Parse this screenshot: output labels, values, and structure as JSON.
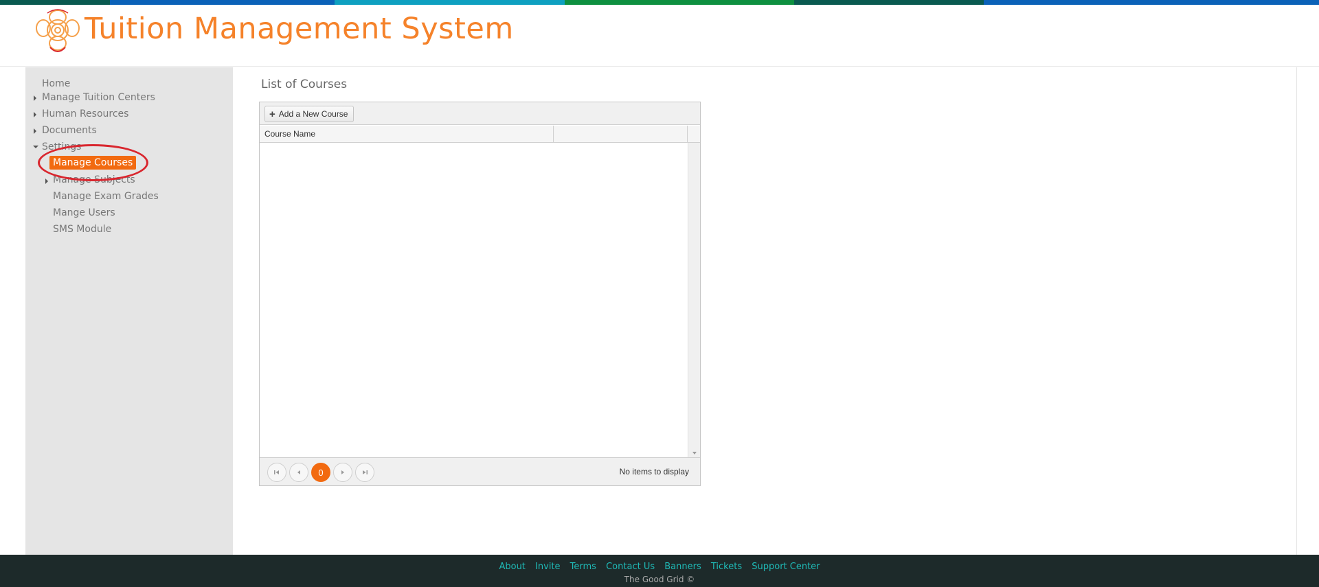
{
  "colors": {
    "accent": "#f26a10",
    "title_orange": "#f5822a",
    "highlight_circle": "#d9262e",
    "footer_bg": "#1d2a2a",
    "footer_link": "#1fb9b6",
    "topbar": [
      "#0a5a50",
      "#0b62b8",
      "#0ea0c0",
      "#0e9040",
      "#0a5a50",
      "#0b62b8"
    ]
  },
  "header": {
    "logo_icon": "flower-logo-icon",
    "title": "Tuition Management System"
  },
  "sidebar": {
    "items": [
      {
        "label": "Home"
      },
      {
        "label": "Manage Tuition Centers"
      },
      {
        "label": "Human Resources"
      },
      {
        "label": "Documents"
      },
      {
        "label": "Settings"
      },
      {
        "label": "Manage Courses"
      },
      {
        "label": "Manage Subjects"
      },
      {
        "label": "Manage Exam Grades"
      },
      {
        "label": "Mange Users"
      },
      {
        "label": "SMS Module"
      }
    ]
  },
  "main": {
    "title": "List of Courses",
    "grid": {
      "add_button_label": "Add a New Course",
      "columns": [
        "Course Name",
        ""
      ],
      "rows": [],
      "pager": {
        "current_page": "0",
        "info": "No items to display"
      }
    }
  },
  "footer": {
    "links": [
      "About",
      "Invite",
      "Terms",
      "Contact Us",
      "Banners",
      "Tickets",
      "Support Center"
    ],
    "copyright": "The Good Grid ©"
  }
}
